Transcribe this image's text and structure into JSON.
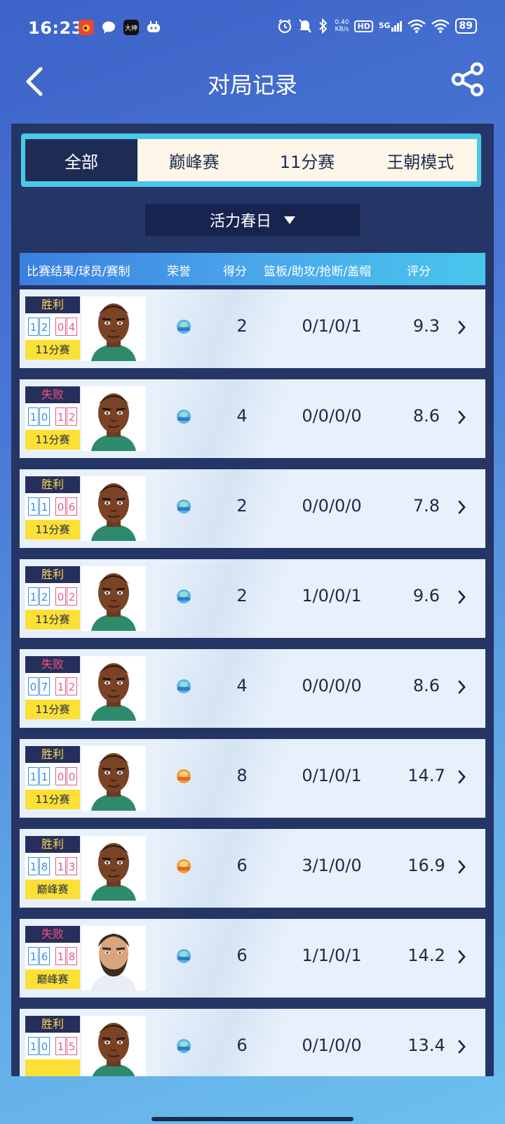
{
  "status": {
    "time": "16:23",
    "net_speed_top": "0.40",
    "net_speed_bottom": "KB/s",
    "hd": "HD",
    "network": "5G",
    "battery": "89",
    "app_icons": [
      "weibo-icon",
      "chat-bubble-icon",
      "dashen-icon",
      "game-controller-icon"
    ],
    "dashen_label": "大神"
  },
  "header": {
    "title": "对局记录"
  },
  "tabs": [
    {
      "label": "全部",
      "active": true
    },
    {
      "label": "巅峰赛",
      "active": false
    },
    {
      "label": "11分赛",
      "active": false
    },
    {
      "label": "王朝模式",
      "active": false
    }
  ],
  "filter": {
    "season": "活力春日"
  },
  "table_header": {
    "result": "比赛结果/球员/赛制",
    "honor": "荣誉",
    "points": "得分",
    "stats": "篮板/助攻/抢断/盖帽",
    "rating": "评分"
  },
  "rows": [
    {
      "result": "胜利",
      "win": true,
      "score_a": [
        "1",
        "2"
      ],
      "score_b": [
        "0",
        "4"
      ],
      "mode": "11分赛",
      "honor": "honor-badge-blue",
      "points": "2",
      "stats": "0/1/0/1",
      "rating": "9.3",
      "player": "player-a"
    },
    {
      "result": "失败",
      "win": false,
      "score_a": [
        "1",
        "0"
      ],
      "score_b": [
        "1",
        "2"
      ],
      "mode": "11分赛",
      "honor": "honor-badge-blue",
      "points": "4",
      "stats": "0/0/0/0",
      "rating": "8.6",
      "player": "player-a"
    },
    {
      "result": "胜利",
      "win": true,
      "score_a": [
        "1",
        "1"
      ],
      "score_b": [
        "0",
        "6"
      ],
      "mode": "11分赛",
      "honor": "honor-badge-blue",
      "points": "2",
      "stats": "0/0/0/0",
      "rating": "7.8",
      "player": "player-a"
    },
    {
      "result": "胜利",
      "win": true,
      "score_a": [
        "1",
        "2"
      ],
      "score_b": [
        "0",
        "2"
      ],
      "mode": "11分赛",
      "honor": "honor-badge-blue",
      "points": "2",
      "stats": "1/0/0/1",
      "rating": "9.6",
      "player": "player-a"
    },
    {
      "result": "失败",
      "win": false,
      "score_a": [
        "0",
        "7"
      ],
      "score_b": [
        "1",
        "2"
      ],
      "mode": "11分赛",
      "honor": "honor-badge-blue",
      "points": "4",
      "stats": "0/0/0/0",
      "rating": "8.6",
      "player": "player-a"
    },
    {
      "result": "胜利",
      "win": true,
      "score_a": [
        "1",
        "1"
      ],
      "score_b": [
        "0",
        "0"
      ],
      "mode": "11分赛",
      "honor": "honor-badge-orange",
      "points": "8",
      "stats": "0/1/0/1",
      "rating": "14.7",
      "player": "player-a"
    },
    {
      "result": "胜利",
      "win": true,
      "score_a": [
        "1",
        "8"
      ],
      "score_b": [
        "1",
        "3"
      ],
      "mode": "巅峰赛",
      "honor": "honor-badge-orange",
      "points": "6",
      "stats": "3/1/0/0",
      "rating": "16.9",
      "player": "player-a"
    },
    {
      "result": "失败",
      "win": false,
      "score_a": [
        "1",
        "6"
      ],
      "score_b": [
        "1",
        "8"
      ],
      "mode": "巅峰赛",
      "honor": "honor-badge-blue",
      "points": "6",
      "stats": "1/1/0/1",
      "rating": "14.2",
      "player": "player-b"
    },
    {
      "result": "胜利",
      "win": true,
      "score_a": [
        "1",
        "0"
      ],
      "score_b": [
        "1",
        "5"
      ],
      "mode": "",
      "honor": "honor-badge-blue",
      "points": "6",
      "stats": "0/1/0/0",
      "rating": "13.4",
      "player": "player-a"
    }
  ],
  "colors": {
    "panel": "#253566",
    "tab_border": "#49c9e6",
    "win_text": "#ffd94a",
    "lose_text": "#ff4d7a",
    "score_blue": "#3a8fe0",
    "score_pink": "#e25c86",
    "mode_yellow": "#fde035"
  }
}
